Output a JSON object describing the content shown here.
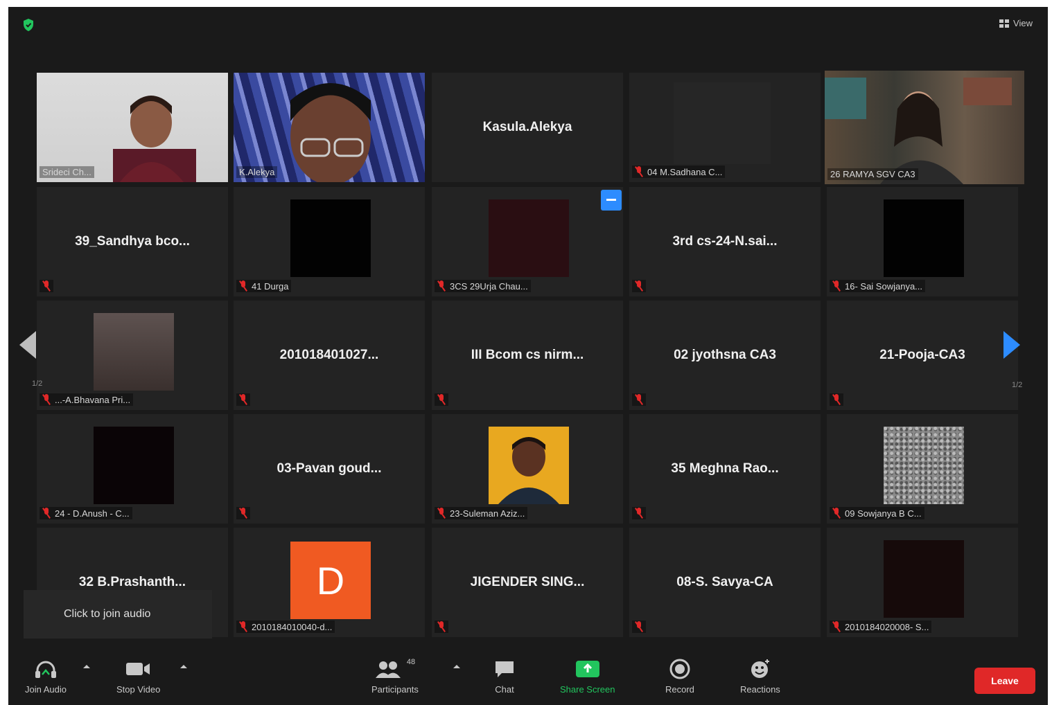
{
  "top_bar": {
    "view_label": "View"
  },
  "tiles": [
    {
      "name": "Srideci Ch...",
      "video": true,
      "active": false
    },
    {
      "name": "K.Alekya",
      "video": true,
      "active": false
    },
    {
      "name": "Kasula.Alekya",
      "video": false,
      "active": false
    },
    {
      "name": "04 M.Sadhana C...",
      "video": false,
      "active": false
    },
    {
      "name": "26 RAMYA SGV CA3",
      "video": true,
      "active": true
    },
    {
      "name": "39_Sandhya bco...",
      "video": false
    },
    {
      "name": "41 Durga",
      "video": false
    },
    {
      "name": "3CS 29Urja Chau...",
      "video": false
    },
    {
      "name": "3rd cs-24-N.sai...",
      "video": false
    },
    {
      "name": "16- Sai Sowjanya...",
      "video": false
    },
    {
      "name": "...-A.Bhavana Pri...",
      "video": false
    },
    {
      "name": "201018401027...",
      "video": false
    },
    {
      "name": "III Bcom cs nirm...",
      "video": false
    },
    {
      "name": "02 jyothsna CA3",
      "video": false
    },
    {
      "name": "21-Pooja-CA3",
      "video": false
    },
    {
      "name": "24 - D.Anush - C...",
      "video": false
    },
    {
      "name": "03-Pavan goud...",
      "video": false
    },
    {
      "name": "23-Suleman Aziz...",
      "video": false
    },
    {
      "name": "35 Meghna Rao...",
      "video": false
    },
    {
      "name": "09 Sowjanya B C...",
      "video": false
    },
    {
      "name": "32 B.Prashanth...",
      "video": false
    },
    {
      "name": "2010184010040-d...",
      "avatar_letter": "D"
    },
    {
      "name": "JIGENDER SING...",
      "video": false
    },
    {
      "name": "08-S. Savya-CA",
      "video": false
    },
    {
      "name": "2010184020008- S...",
      "video": false
    }
  ],
  "pagination": {
    "left": "1/2",
    "right": "1/2"
  },
  "join_audio_tip": "Click to join audio",
  "toolbar": {
    "join_audio": "Join Audio",
    "stop_video": "Stop Video",
    "participants": "Participants",
    "participants_count": "48",
    "chat": "Chat",
    "share_screen": "Share Screen",
    "record": "Record",
    "reactions": "Reactions",
    "leave": "Leave"
  },
  "colors": {
    "accent": "#2d8cff",
    "leave": "#e02828",
    "share": "#22c55e",
    "active_border": "#d9e35a",
    "avatar_bg": "#f05a22"
  }
}
